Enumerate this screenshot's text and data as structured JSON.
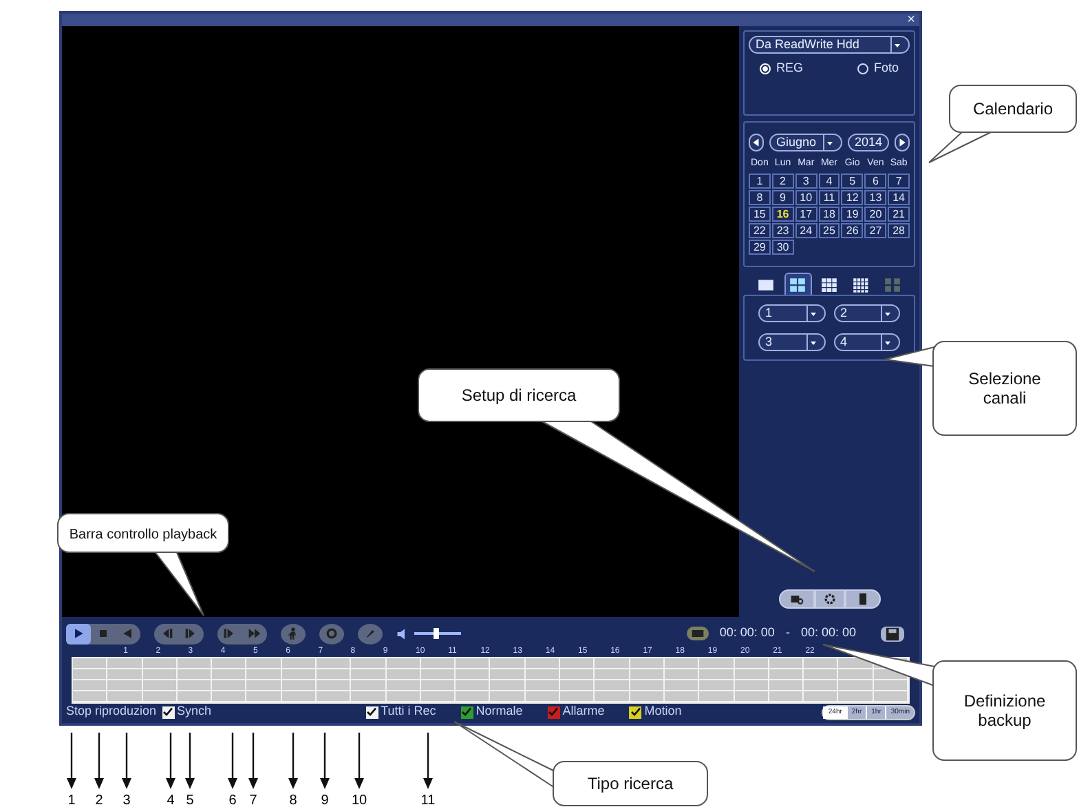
{
  "window": {
    "close": "×"
  },
  "source": {
    "value": "Da ReadWrite Hdd",
    "options": [
      {
        "label": "REG",
        "selected": true
      },
      {
        "label": "Foto",
        "selected": false
      }
    ]
  },
  "calendar": {
    "month": "Giugno",
    "year": "2014",
    "weekdays": [
      "Don",
      "Lun",
      "Mar",
      "Mer",
      "Gio",
      "Ven",
      "Sab"
    ],
    "days": [
      {
        "day": "1",
        "selected": false
      },
      {
        "day": "2",
        "selected": false
      },
      {
        "day": "3",
        "selected": false
      },
      {
        "day": "4",
        "selected": false
      },
      {
        "day": "5",
        "selected": false
      },
      {
        "day": "6",
        "selected": false
      },
      {
        "day": "7",
        "selected": false
      },
      {
        "day": "8",
        "selected": false
      },
      {
        "day": "9",
        "selected": false
      },
      {
        "day": "10",
        "selected": false
      },
      {
        "day": "11",
        "selected": false
      },
      {
        "day": "12",
        "selected": false
      },
      {
        "day": "13",
        "selected": false
      },
      {
        "day": "14",
        "selected": false
      },
      {
        "day": "15",
        "selected": false
      },
      {
        "day": "16",
        "selected": true
      },
      {
        "day": "17",
        "selected": false
      },
      {
        "day": "18",
        "selected": false
      },
      {
        "day": "19",
        "selected": false
      },
      {
        "day": "20",
        "selected": false
      },
      {
        "day": "21",
        "selected": false
      },
      {
        "day": "22",
        "selected": false
      },
      {
        "day": "23",
        "selected": false
      },
      {
        "day": "24",
        "selected": false
      },
      {
        "day": "25",
        "selected": false
      },
      {
        "day": "26",
        "selected": false
      },
      {
        "day": "27",
        "selected": false
      },
      {
        "day": "28",
        "selected": false
      },
      {
        "day": "29",
        "selected": false
      },
      {
        "day": "30",
        "selected": false
      }
    ]
  },
  "layouts": [
    {
      "kind": "single",
      "selected": false
    },
    {
      "kind": "quad",
      "selected": true
    },
    {
      "kind": "nine",
      "selected": false
    },
    {
      "kind": "sixteen",
      "selected": false
    },
    {
      "kind": "disabled",
      "selected": false
    }
  ],
  "channels": [
    "1",
    "2",
    "3",
    "4"
  ],
  "search_buttons": [
    {
      "kind": "search"
    },
    {
      "kind": "settings"
    },
    {
      "kind": "file"
    }
  ],
  "playback_controls": [
    [
      {
        "kind": "play",
        "selected": true
      },
      {
        "kind": "stop",
        "selected": false
      },
      {
        "kind": "reverse",
        "selected": false
      }
    ],
    [
      {
        "kind": "prev_frame",
        "selected": false
      },
      {
        "kind": "next_frame",
        "selected": false
      }
    ],
    [
      {
        "kind": "slow",
        "selected": false
      },
      {
        "kind": "fast",
        "selected": false
      }
    ],
    [
      {
        "kind": "figure",
        "selected": false
      }
    ],
    [
      {
        "kind": "record",
        "selected": false
      }
    ],
    [
      {
        "kind": "mark",
        "selected": false
      }
    ]
  ],
  "volume": {
    "level": 0.45
  },
  "backup": {
    "start": "00: 00: 00",
    "separator": "-",
    "end": "00: 00: 00"
  },
  "timeline": {
    "hours": [
      "1",
      "2",
      "3",
      "4",
      "5",
      "6",
      "7",
      "8",
      "9",
      "10",
      "11",
      "12",
      "13",
      "14",
      "15",
      "16",
      "17",
      "18",
      "19",
      "20",
      "21",
      "22"
    ]
  },
  "status_bar": {
    "message": "Stop riproduzion",
    "sync": {
      "label": "Synch",
      "checked": true
    },
    "record_types": [
      {
        "label": "Tutti i Rec",
        "checked": true,
        "color": "#f2f2f2"
      },
      {
        "label": "Normale",
        "checked": true,
        "color": "#2e9e2e"
      },
      {
        "label": "Allarme",
        "checked": true,
        "color": "#c81e1e"
      },
      {
        "label": "Motion",
        "checked": true,
        "color": "#d8d020"
      }
    ],
    "zoom": [
      {
        "label": "24hr",
        "selected": true
      },
      {
        "label": "2hr",
        "selected": false
      },
      {
        "label": "1hr",
        "selected": false
      },
      {
        "label": "30min",
        "selected": false
      }
    ]
  },
  "callouts": [
    {
      "lines": [
        "Calendario"
      ]
    },
    {
      "lines": [
        "Setup di ricerca"
      ]
    },
    {
      "lines": [
        "Selezione",
        "canali"
      ]
    },
    {
      "lines": [
        "Barra controllo playback"
      ]
    },
    {
      "lines": [
        "Definizione",
        "backup"
      ]
    },
    {
      "lines": [
        "Tipo ricerca"
      ]
    }
  ],
  "markers": [
    "1",
    "2",
    "3",
    "4",
    "5",
    "6",
    "7",
    "8",
    "9",
    "10",
    "11"
  ]
}
